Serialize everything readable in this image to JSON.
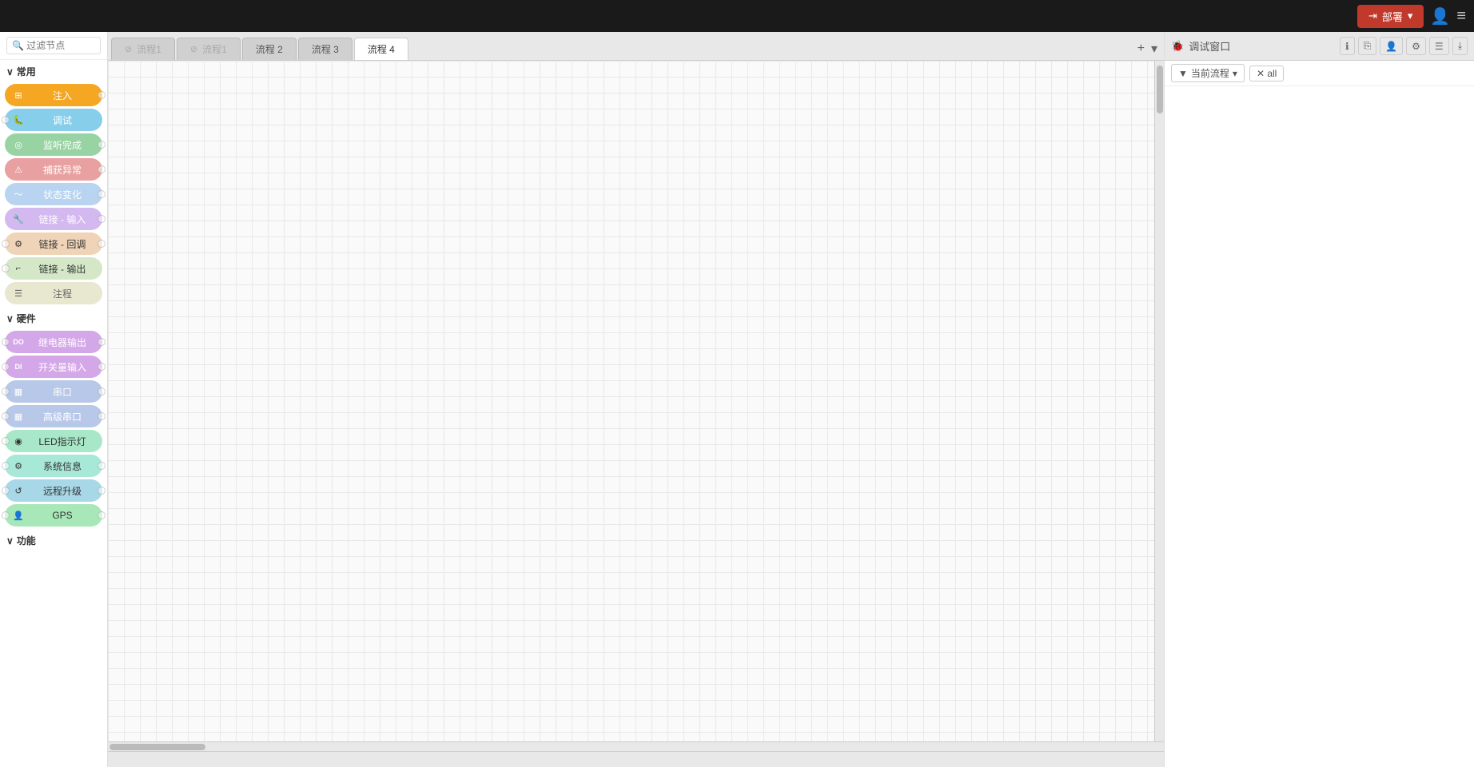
{
  "topbar": {
    "deploy_label": "部署",
    "deploy_dropdown_icon": "▾",
    "user_icon": "👤",
    "menu_icon": "≡"
  },
  "sidebar": {
    "search_placeholder": "🔍 过滤节点",
    "sections": [
      {
        "id": "common",
        "label": "常用",
        "collapsed": false,
        "nodes": [
          {
            "id": "inject",
            "label": "注入",
            "color": "inject",
            "icon": "⊞",
            "has_left": false,
            "has_right": true
          },
          {
            "id": "debug",
            "label": "调试",
            "color": "debug",
            "icon": "🐛",
            "has_left": true,
            "has_right": false
          },
          {
            "id": "complete",
            "label": "监听完成",
            "color": "complete",
            "icon": "◎",
            "has_left": false,
            "has_right": true
          },
          {
            "id": "catch",
            "label": "捕获异常",
            "color": "catch",
            "icon": "⚠",
            "has_left": false,
            "has_right": true
          },
          {
            "id": "status",
            "label": "状态变化",
            "color": "status",
            "icon": "〜",
            "has_left": false,
            "has_right": true
          },
          {
            "id": "link-in",
            "label": "链接 - 输入",
            "color": "link-in",
            "icon": "🔧",
            "has_left": false,
            "has_right": true
          },
          {
            "id": "link-call",
            "label": "链接 - 回调",
            "color": "link-call",
            "icon": "⚙",
            "has_left": true,
            "has_right": true
          },
          {
            "id": "link-out",
            "label": "链接 - 输出",
            "color": "link-out",
            "icon": "⌐",
            "has_left": true,
            "has_right": false
          },
          {
            "id": "comment",
            "label": "注程",
            "color": "comment",
            "icon": "☰",
            "has_left": false,
            "has_right": false
          }
        ]
      },
      {
        "id": "hardware",
        "label": "硬件",
        "collapsed": false,
        "nodes": [
          {
            "id": "relay",
            "label": "继电器输出",
            "color": "relay",
            "icon": "DO",
            "has_left": true,
            "has_right": true
          },
          {
            "id": "switch-in",
            "label": "开关量输入",
            "color": "switch-in",
            "icon": "DI",
            "has_left": true,
            "has_right": true
          },
          {
            "id": "serial",
            "label": "串口",
            "color": "serial",
            "icon": "▦",
            "has_left": true,
            "has_right": true
          },
          {
            "id": "serial-adv",
            "label": "高级串口",
            "color": "serial-adv",
            "icon": "▦",
            "has_left": true,
            "has_right": true
          },
          {
            "id": "led",
            "label": "LED指示灯",
            "color": "led",
            "icon": "◉",
            "has_left": true,
            "has_right": false
          },
          {
            "id": "sysinfo",
            "label": "系统信息",
            "color": "sysinfo",
            "icon": "⚙",
            "has_left": true,
            "has_right": true
          },
          {
            "id": "ota",
            "label": "远程升级",
            "color": "ota",
            "icon": "↺",
            "has_left": true,
            "has_right": true
          },
          {
            "id": "gps",
            "label": "GPS",
            "color": "gps",
            "icon": "👤",
            "has_left": true,
            "has_right": true
          }
        ]
      },
      {
        "id": "function",
        "label": "功能",
        "collapsed": false,
        "nodes": []
      }
    ]
  },
  "tabs": [
    {
      "id": "tab-flow-disabled1",
      "label": "流程1",
      "active": false,
      "disabled": true,
      "icon": "⊘"
    },
    {
      "id": "tab-flow-disabled2",
      "label": "流程1",
      "active": false,
      "disabled": true,
      "icon": "⊘"
    },
    {
      "id": "tab-flow2",
      "label": "流程 2",
      "active": false,
      "disabled": false
    },
    {
      "id": "tab-flow3",
      "label": "流程 3",
      "active": false,
      "disabled": false
    },
    {
      "id": "tab-flow4",
      "label": "流程 4",
      "active": true,
      "disabled": false
    }
  ],
  "tab_actions": {
    "add_label": "+",
    "more_label": "▾"
  },
  "canvas": {
    "empty": true
  },
  "right_panel": {
    "title": "调试窗口",
    "title_icon": "🐞",
    "actions": {
      "info_label": "ℹ",
      "copy_label": "⎘",
      "user_label": "👤",
      "settings_label": "⚙",
      "list_label": "☰",
      "export_label": "⤓"
    },
    "filter_label": "当前流程",
    "clear_label": "✕ all"
  },
  "status_bar": {
    "left": "",
    "center": "",
    "right": ""
  }
}
